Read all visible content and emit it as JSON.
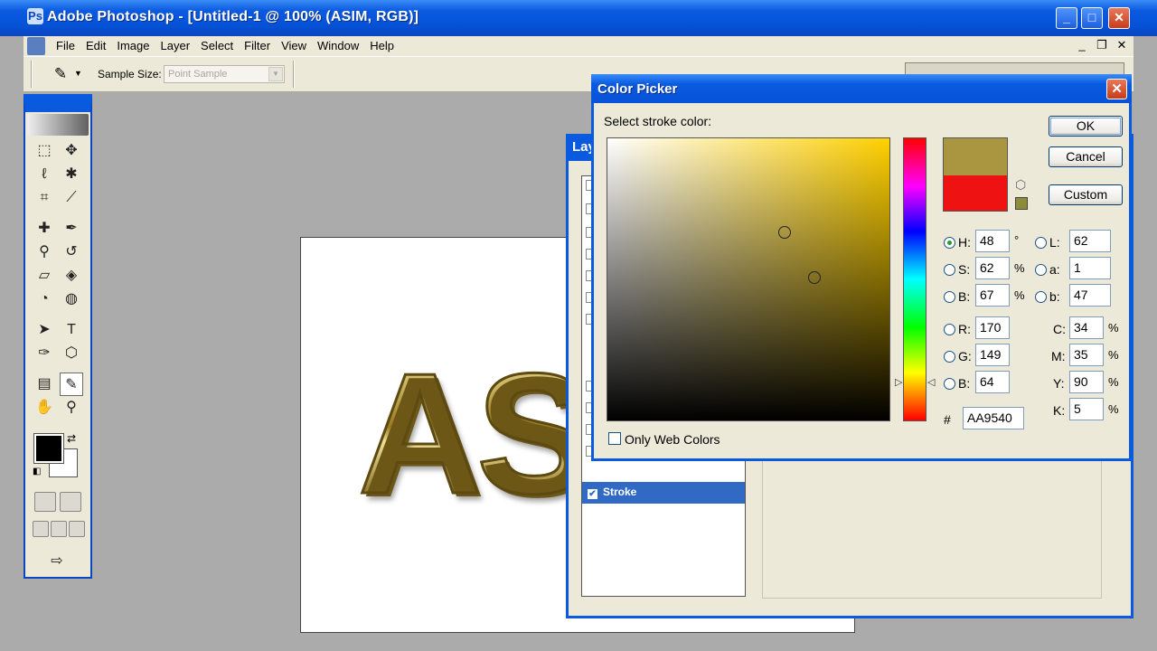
{
  "window": {
    "title": "Adobe Photoshop - [Untitled-1 @ 100% (ASIM, RGB)]",
    "minimize": "_",
    "maximize": "□",
    "close": "✕"
  },
  "menu": {
    "items": [
      "File",
      "Edit",
      "Image",
      "Layer",
      "Select",
      "Filter",
      "View",
      "Window",
      "Help"
    ],
    "doc_min": "_",
    "doc_restore": "❐",
    "doc_close": "✕"
  },
  "options": {
    "sample_size_label": "Sample Size:",
    "sample_size_value": "Point Sample"
  },
  "canvas": {
    "text": "ASIM"
  },
  "layer_style": {
    "title": "Lay",
    "selected_item": "Stroke"
  },
  "color_picker": {
    "title": "Color Picker",
    "prompt": "Select stroke color:",
    "buttons": {
      "ok": "OK",
      "cancel": "Cancel",
      "custom": "Custom"
    },
    "hsb": {
      "h": "48",
      "s": "62",
      "b": "67"
    },
    "rgb": {
      "r": "170",
      "g": "149",
      "b": "64"
    },
    "lab": {
      "l": "62",
      "a": "1",
      "b": "47"
    },
    "cmyk": {
      "c": "34",
      "m": "35",
      "y": "90",
      "k": "5"
    },
    "hex": "AA9540",
    "labels": {
      "h": "H:",
      "s": "S:",
      "b": "B:",
      "r": "R:",
      "g": "G:",
      "b2": "B:",
      "l": "L:",
      "a": "a:",
      "lb": "b:",
      "c": "C:",
      "m": "M:",
      "y": "Y:",
      "k": "K:",
      "hash": "#"
    },
    "units": {
      "deg": "°",
      "pct": "%"
    },
    "only_web_colors": "Only Web Colors",
    "new_color": "#aa9540",
    "current_color": "#ee1212"
  }
}
